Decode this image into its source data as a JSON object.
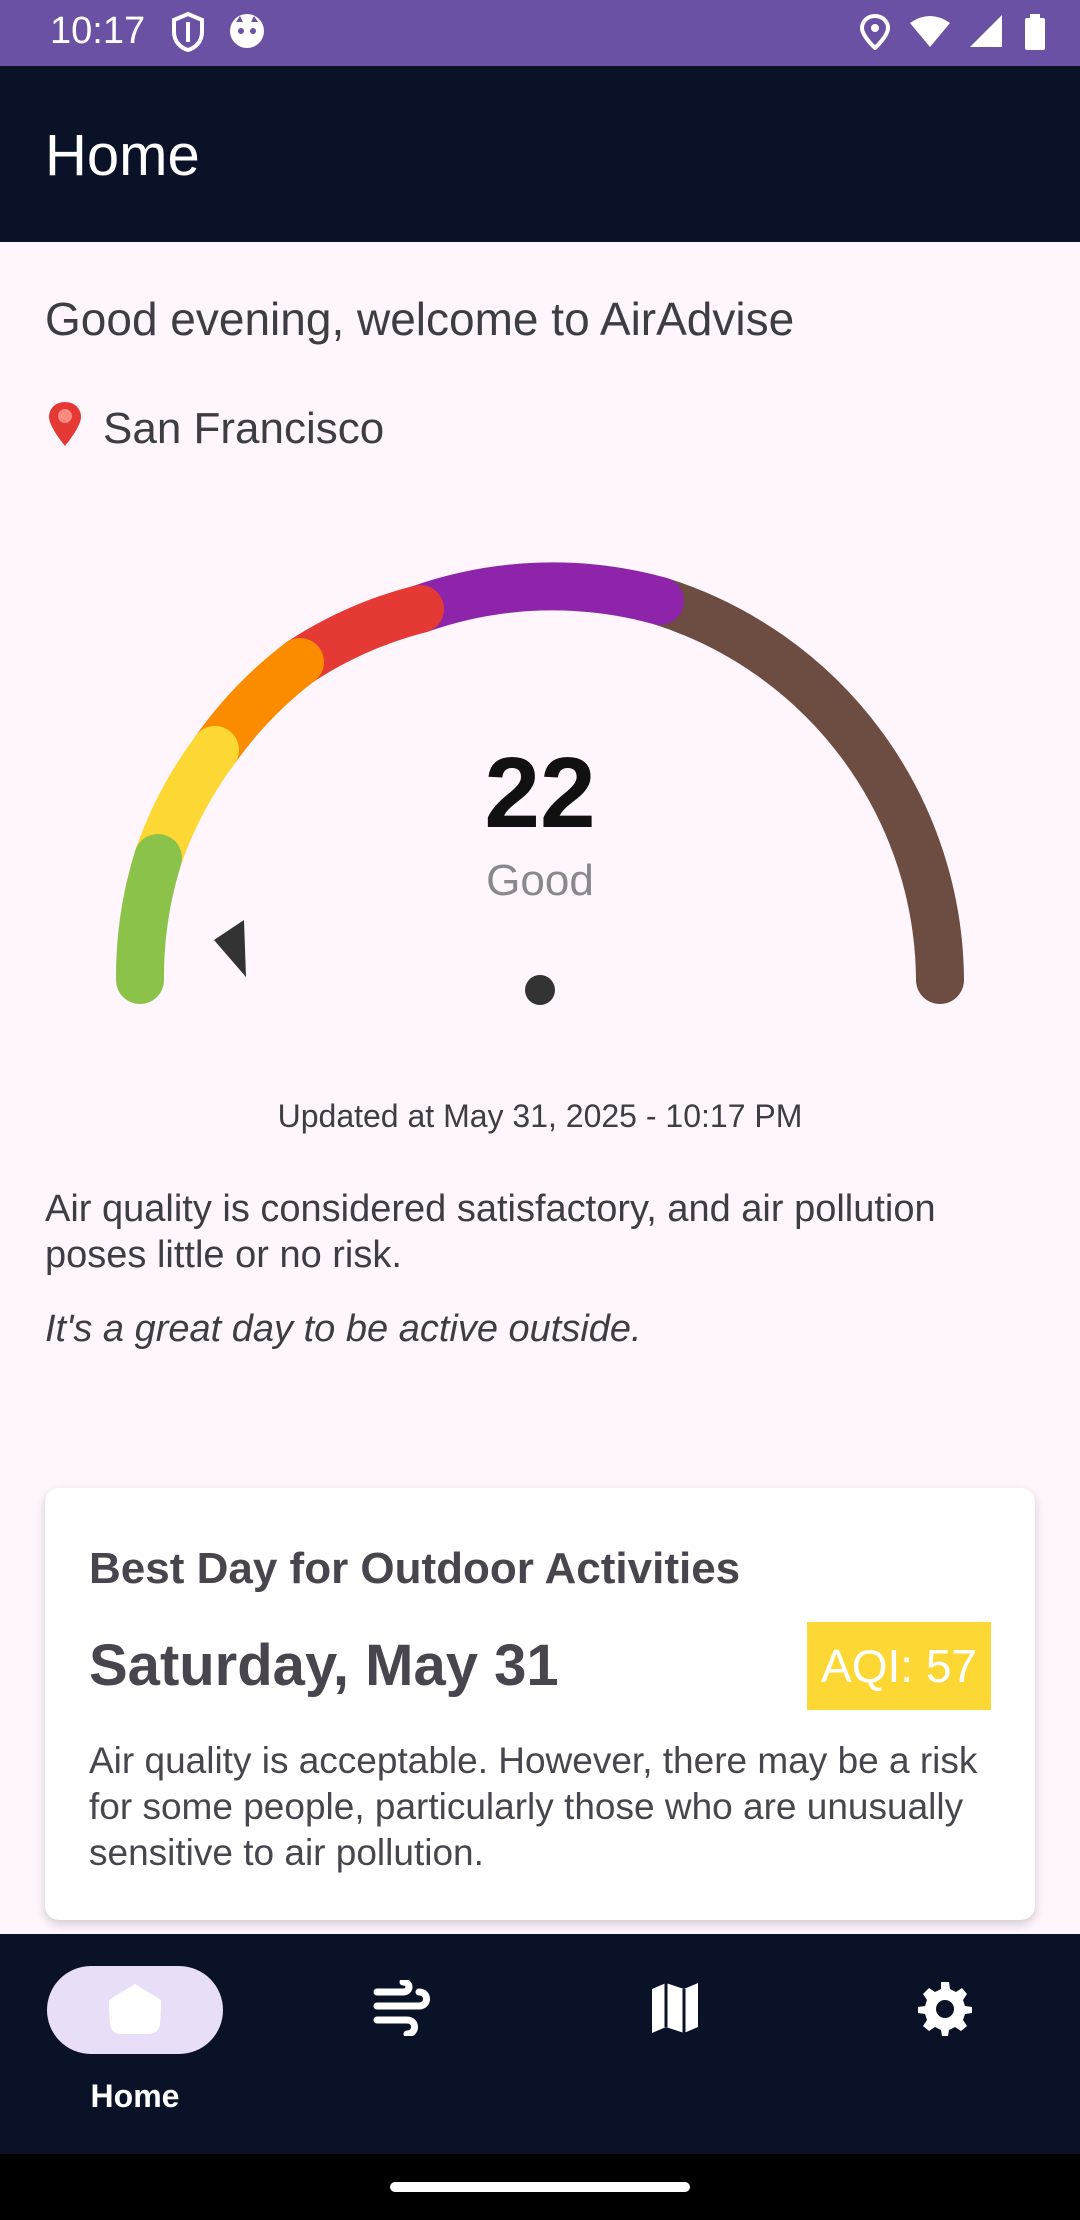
{
  "status_bar": {
    "time": "10:17",
    "icons_left": [
      "shield-icon",
      "cat-icon"
    ],
    "icons_right": [
      "location-icon",
      "wifi-icon",
      "signal-icon",
      "battery-icon"
    ]
  },
  "app_bar": {
    "title": "Home"
  },
  "greeting": "Good evening, welcome to AirAdvise",
  "location": {
    "icon": "pin-icon",
    "text": "San Francisco"
  },
  "gauge": {
    "value": "22",
    "category": "Good",
    "colors": [
      "#8BC34A",
      "#FDD835",
      "#FB8C00",
      "#E53935",
      "#8E24AA",
      "#6D4C41"
    ]
  },
  "updated_text": "Updated at May 31, 2025 - 10:17 PM",
  "description": "Air quality is considered satisfactory, and air pollution poses little or no risk.",
  "tip": "It's a great day to be active outside.",
  "best_day_card": {
    "title": "Best Day for Outdoor Activities",
    "date": "Saturday, May 31",
    "aqi_label": "AQI: 57",
    "badge_color": "#FDD835",
    "text": "Air quality is acceptable. However, there may be a risk for some people, particularly those who are unusually sensitive to air pollution."
  },
  "bottom_nav": {
    "items": [
      {
        "label": "Home",
        "icon": "home-icon",
        "selected": true
      },
      {
        "label": "",
        "icon": "air-icon",
        "selected": false
      },
      {
        "label": "",
        "icon": "map-icon",
        "selected": false
      },
      {
        "label": "",
        "icon": "settings-icon",
        "selected": false
      }
    ]
  }
}
